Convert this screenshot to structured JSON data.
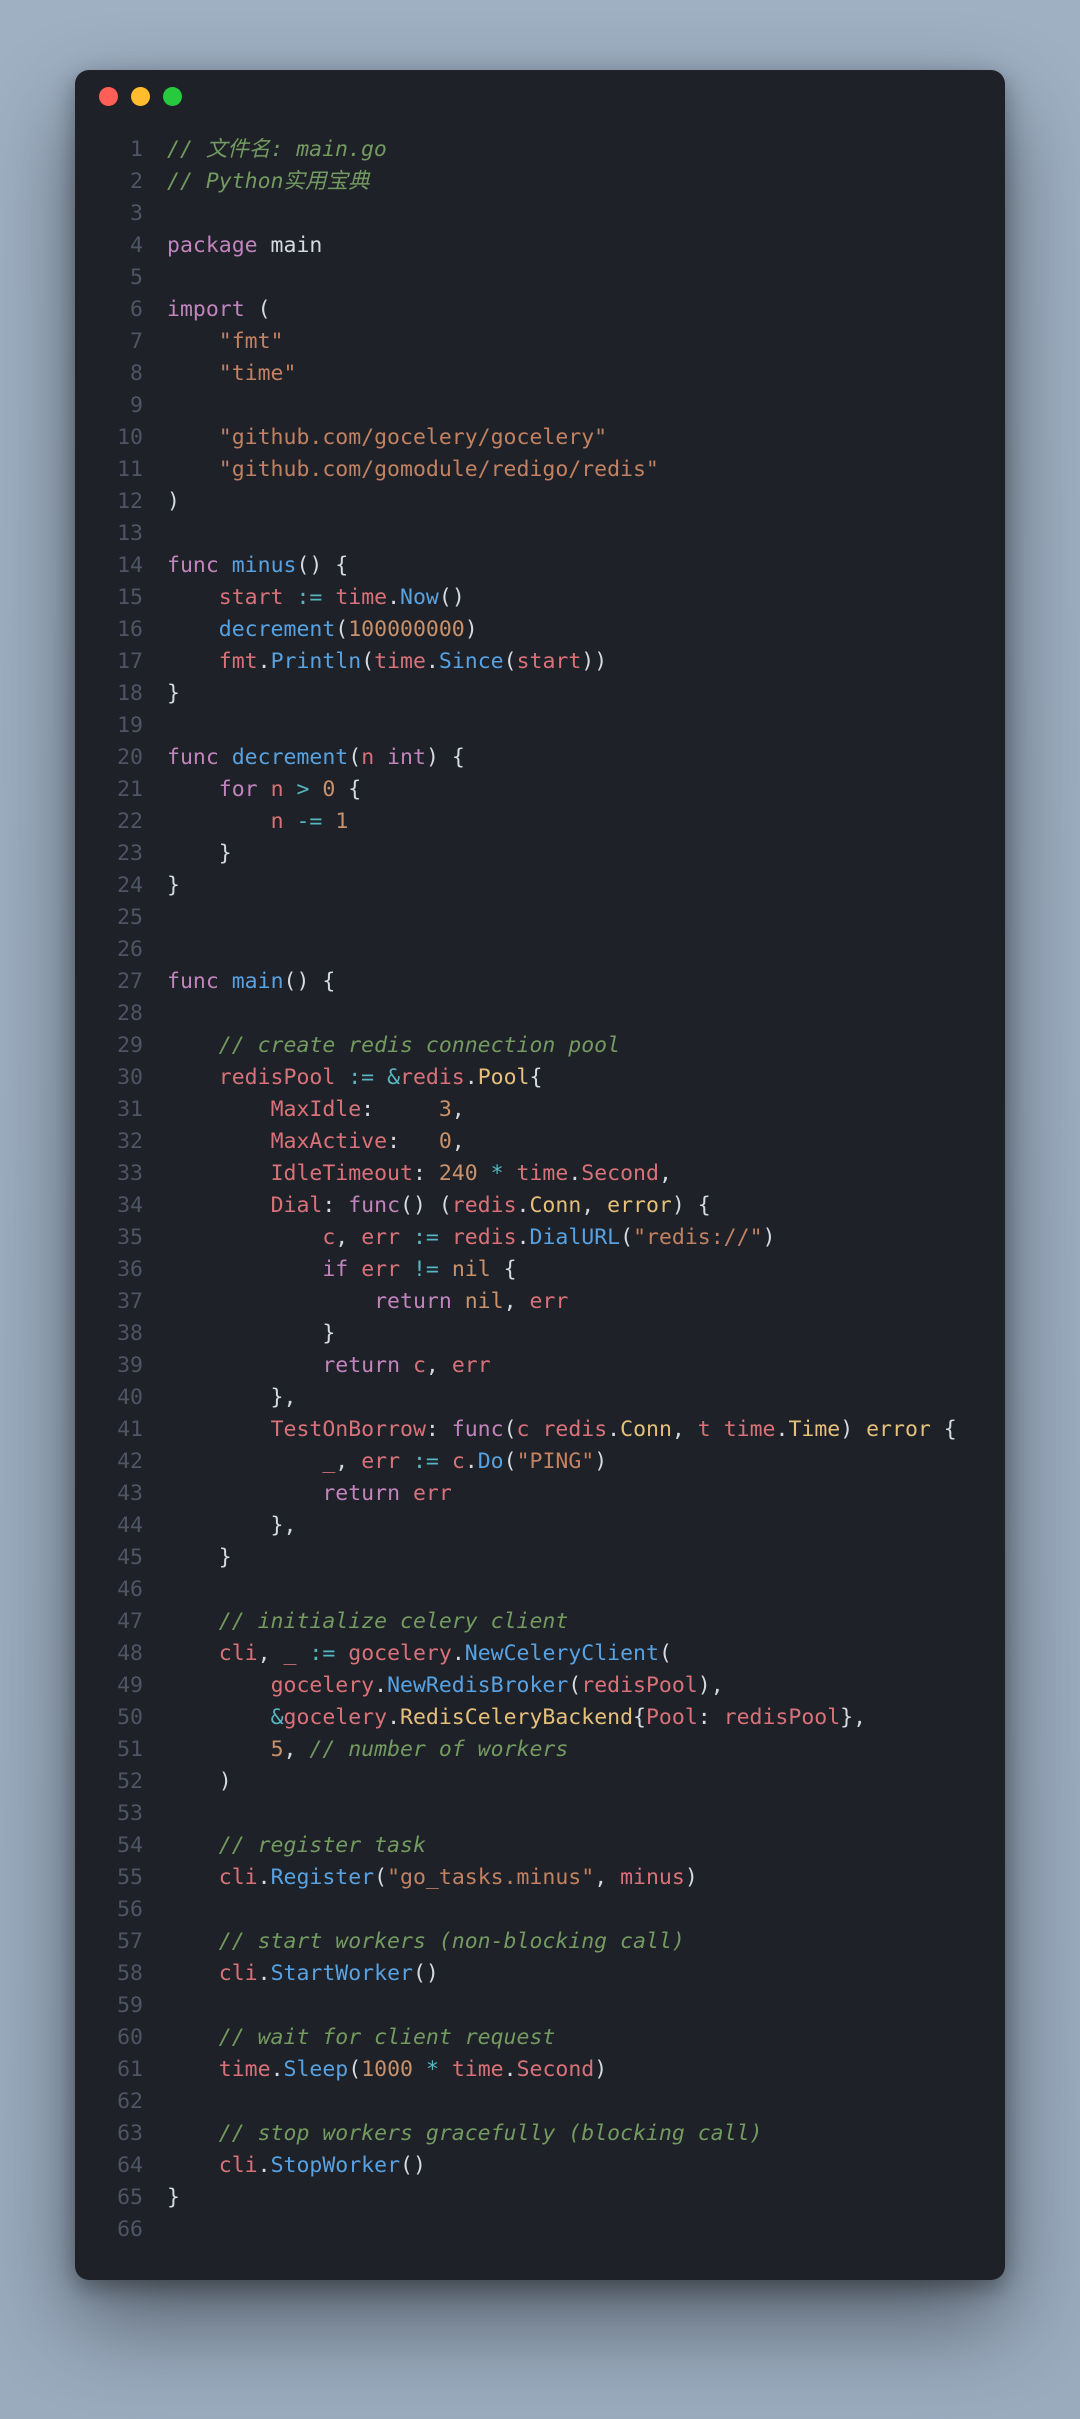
{
  "window": {
    "traffic_lights": [
      "red",
      "yellow",
      "green"
    ]
  },
  "code": {
    "lines": [
      [
        [
          "com",
          "// 文件名: main.go"
        ]
      ],
      [
        [
          "com",
          "// Python实用宝典"
        ]
      ],
      [],
      [
        [
          "kw",
          "package"
        ],
        [
          "wh",
          " main"
        ]
      ],
      [],
      [
        [
          "kw",
          "import"
        ],
        [
          "wh",
          " ("
        ]
      ],
      [
        [
          "wh",
          "    "
        ],
        [
          "str",
          "\"fmt\""
        ]
      ],
      [
        [
          "wh",
          "    "
        ],
        [
          "str",
          "\"time\""
        ]
      ],
      [],
      [
        [
          "wh",
          "    "
        ],
        [
          "str",
          "\"github.com/gocelery/gocelery\""
        ]
      ],
      [
        [
          "wh",
          "    "
        ],
        [
          "str",
          "\"github.com/gomodule/redigo/redis\""
        ]
      ],
      [
        [
          "wh",
          ")"
        ]
      ],
      [],
      [
        [
          "kw",
          "func"
        ],
        [
          "wh",
          " "
        ],
        [
          "func",
          "minus"
        ],
        [
          "wh",
          "() {"
        ]
      ],
      [
        [
          "wh",
          "    "
        ],
        [
          "red",
          "start"
        ],
        [
          "wh",
          " "
        ],
        [
          "op",
          ":="
        ],
        [
          "wh",
          " "
        ],
        [
          "red",
          "time"
        ],
        [
          "wh",
          "."
        ],
        [
          "func",
          "Now"
        ],
        [
          "wh",
          "()"
        ]
      ],
      [
        [
          "wh",
          "    "
        ],
        [
          "func",
          "decrement"
        ],
        [
          "wh",
          "("
        ],
        [
          "num",
          "100000000"
        ],
        [
          "wh",
          ")"
        ]
      ],
      [
        [
          "wh",
          "    "
        ],
        [
          "red",
          "fmt"
        ],
        [
          "wh",
          "."
        ],
        [
          "func",
          "Println"
        ],
        [
          "wh",
          "("
        ],
        [
          "red",
          "time"
        ],
        [
          "wh",
          "."
        ],
        [
          "func",
          "Since"
        ],
        [
          "wh",
          "("
        ],
        [
          "red",
          "start"
        ],
        [
          "wh",
          "))"
        ]
      ],
      [
        [
          "wh",
          "}"
        ]
      ],
      [],
      [
        [
          "kw",
          "func"
        ],
        [
          "wh",
          " "
        ],
        [
          "func",
          "decrement"
        ],
        [
          "wh",
          "("
        ],
        [
          "red",
          "n"
        ],
        [
          "wh",
          " "
        ],
        [
          "kw",
          "int"
        ],
        [
          "wh",
          ") {"
        ]
      ],
      [
        [
          "wh",
          "    "
        ],
        [
          "kw",
          "for"
        ],
        [
          "wh",
          " "
        ],
        [
          "red",
          "n"
        ],
        [
          "wh",
          " "
        ],
        [
          "op",
          ">"
        ],
        [
          "wh",
          " "
        ],
        [
          "num",
          "0"
        ],
        [
          "wh",
          " {"
        ]
      ],
      [
        [
          "wh",
          "        "
        ],
        [
          "red",
          "n"
        ],
        [
          "wh",
          " "
        ],
        [
          "op",
          "-="
        ],
        [
          "wh",
          " "
        ],
        [
          "num",
          "1"
        ]
      ],
      [
        [
          "wh",
          "    }"
        ]
      ],
      [
        [
          "wh",
          "}"
        ]
      ],
      [],
      [],
      [
        [
          "kw",
          "func"
        ],
        [
          "wh",
          " "
        ],
        [
          "func",
          "main"
        ],
        [
          "wh",
          "() {"
        ]
      ],
      [],
      [
        [
          "wh",
          "    "
        ],
        [
          "com",
          "// create redis connection pool"
        ]
      ],
      [
        [
          "wh",
          "    "
        ],
        [
          "red",
          "redisPool"
        ],
        [
          "wh",
          " "
        ],
        [
          "op",
          ":="
        ],
        [
          "wh",
          " "
        ],
        [
          "op",
          "&"
        ],
        [
          "red",
          "redis"
        ],
        [
          "wh",
          "."
        ],
        [
          "yel",
          "Pool"
        ],
        [
          "wh",
          "{"
        ]
      ],
      [
        [
          "wh",
          "        "
        ],
        [
          "red",
          "MaxIdle"
        ],
        [
          "wh",
          ":     "
        ],
        [
          "num",
          "3"
        ],
        [
          "wh",
          ","
        ]
      ],
      [
        [
          "wh",
          "        "
        ],
        [
          "red",
          "MaxActive"
        ],
        [
          "wh",
          ":   "
        ],
        [
          "num",
          "0"
        ],
        [
          "wh",
          ","
        ]
      ],
      [
        [
          "wh",
          "        "
        ],
        [
          "red",
          "IdleTimeout"
        ],
        [
          "wh",
          ": "
        ],
        [
          "num",
          "240"
        ],
        [
          "wh",
          " "
        ],
        [
          "op",
          "*"
        ],
        [
          "wh",
          " "
        ],
        [
          "red",
          "time"
        ],
        [
          "wh",
          "."
        ],
        [
          "red",
          "Second"
        ],
        [
          "wh",
          ","
        ]
      ],
      [
        [
          "wh",
          "        "
        ],
        [
          "red",
          "Dial"
        ],
        [
          "wh",
          ": "
        ],
        [
          "kw",
          "func"
        ],
        [
          "wh",
          "() ("
        ],
        [
          "red",
          "redis"
        ],
        [
          "wh",
          "."
        ],
        [
          "yel",
          "Conn"
        ],
        [
          "wh",
          ", "
        ],
        [
          "yel",
          "error"
        ],
        [
          "wh",
          ") {"
        ]
      ],
      [
        [
          "wh",
          "            "
        ],
        [
          "red",
          "c"
        ],
        [
          "wh",
          ", "
        ],
        [
          "red",
          "err"
        ],
        [
          "wh",
          " "
        ],
        [
          "op",
          ":="
        ],
        [
          "wh",
          " "
        ],
        [
          "red",
          "redis"
        ],
        [
          "wh",
          "."
        ],
        [
          "func",
          "DialURL"
        ],
        [
          "wh",
          "("
        ],
        [
          "str",
          "\"redis://\""
        ],
        [
          "wh",
          ")"
        ]
      ],
      [
        [
          "wh",
          "            "
        ],
        [
          "kw",
          "if"
        ],
        [
          "wh",
          " "
        ],
        [
          "red",
          "err"
        ],
        [
          "wh",
          " "
        ],
        [
          "op",
          "!="
        ],
        [
          "wh",
          " "
        ],
        [
          "num",
          "nil"
        ],
        [
          "wh",
          " {"
        ]
      ],
      [
        [
          "wh",
          "                "
        ],
        [
          "kw",
          "return"
        ],
        [
          "wh",
          " "
        ],
        [
          "num",
          "nil"
        ],
        [
          "wh",
          ", "
        ],
        [
          "red",
          "err"
        ]
      ],
      [
        [
          "wh",
          "            }"
        ]
      ],
      [
        [
          "wh",
          "            "
        ],
        [
          "kw",
          "return"
        ],
        [
          "wh",
          " "
        ],
        [
          "red",
          "c"
        ],
        [
          "wh",
          ", "
        ],
        [
          "red",
          "err"
        ]
      ],
      [
        [
          "wh",
          "        },"
        ]
      ],
      [
        [
          "wh",
          "        "
        ],
        [
          "red",
          "TestOnBorrow"
        ],
        [
          "wh",
          ": "
        ],
        [
          "kw",
          "func"
        ],
        [
          "wh",
          "("
        ],
        [
          "red",
          "c"
        ],
        [
          "wh",
          " "
        ],
        [
          "red",
          "redis"
        ],
        [
          "wh",
          "."
        ],
        [
          "yel",
          "Conn"
        ],
        [
          "wh",
          ", "
        ],
        [
          "red",
          "t"
        ],
        [
          "wh",
          " "
        ],
        [
          "red",
          "time"
        ],
        [
          "wh",
          "."
        ],
        [
          "yel",
          "Time"
        ],
        [
          "wh",
          ") "
        ],
        [
          "yel",
          "error"
        ],
        [
          "wh",
          " {"
        ]
      ],
      [
        [
          "wh",
          "            "
        ],
        [
          "red",
          "_"
        ],
        [
          "wh",
          ", "
        ],
        [
          "red",
          "err"
        ],
        [
          "wh",
          " "
        ],
        [
          "op",
          ":="
        ],
        [
          "wh",
          " "
        ],
        [
          "red",
          "c"
        ],
        [
          "wh",
          "."
        ],
        [
          "func",
          "Do"
        ],
        [
          "wh",
          "("
        ],
        [
          "str",
          "\"PING\""
        ],
        [
          "wh",
          ")"
        ]
      ],
      [
        [
          "wh",
          "            "
        ],
        [
          "kw",
          "return"
        ],
        [
          "wh",
          " "
        ],
        [
          "red",
          "err"
        ]
      ],
      [
        [
          "wh",
          "        },"
        ]
      ],
      [
        [
          "wh",
          "    }"
        ]
      ],
      [],
      [
        [
          "wh",
          "    "
        ],
        [
          "com",
          "// initialize celery client"
        ]
      ],
      [
        [
          "wh",
          "    "
        ],
        [
          "red",
          "cli"
        ],
        [
          "wh",
          ", "
        ],
        [
          "red",
          "_"
        ],
        [
          "wh",
          " "
        ],
        [
          "op",
          ":="
        ],
        [
          "wh",
          " "
        ],
        [
          "red",
          "gocelery"
        ],
        [
          "wh",
          "."
        ],
        [
          "func",
          "NewCeleryClient"
        ],
        [
          "wh",
          "("
        ]
      ],
      [
        [
          "wh",
          "        "
        ],
        [
          "red",
          "gocelery"
        ],
        [
          "wh",
          "."
        ],
        [
          "func",
          "NewRedisBroker"
        ],
        [
          "wh",
          "("
        ],
        [
          "red",
          "redisPool"
        ],
        [
          "wh",
          "),"
        ]
      ],
      [
        [
          "wh",
          "        "
        ],
        [
          "op",
          "&"
        ],
        [
          "red",
          "gocelery"
        ],
        [
          "wh",
          "."
        ],
        [
          "yel",
          "RedisCeleryBackend"
        ],
        [
          "wh",
          "{"
        ],
        [
          "red",
          "Pool"
        ],
        [
          "wh",
          ": "
        ],
        [
          "red",
          "redisPool"
        ],
        [
          "wh",
          "},"
        ]
      ],
      [
        [
          "wh",
          "        "
        ],
        [
          "num",
          "5"
        ],
        [
          "wh",
          ", "
        ],
        [
          "com",
          "// number of workers"
        ]
      ],
      [
        [
          "wh",
          "    )"
        ]
      ],
      [],
      [
        [
          "wh",
          "    "
        ],
        [
          "com",
          "// register task"
        ]
      ],
      [
        [
          "wh",
          "    "
        ],
        [
          "red",
          "cli"
        ],
        [
          "wh",
          "."
        ],
        [
          "func",
          "Register"
        ],
        [
          "wh",
          "("
        ],
        [
          "str",
          "\"go_tasks.minus\""
        ],
        [
          "wh",
          ", "
        ],
        [
          "red",
          "minus"
        ],
        [
          "wh",
          ")"
        ]
      ],
      [],
      [
        [
          "wh",
          "    "
        ],
        [
          "com",
          "// start workers (non-blocking call)"
        ]
      ],
      [
        [
          "wh",
          "    "
        ],
        [
          "red",
          "cli"
        ],
        [
          "wh",
          "."
        ],
        [
          "func",
          "StartWorker"
        ],
        [
          "wh",
          "()"
        ]
      ],
      [],
      [
        [
          "wh",
          "    "
        ],
        [
          "com",
          "// wait for client request"
        ]
      ],
      [
        [
          "wh",
          "    "
        ],
        [
          "red",
          "time"
        ],
        [
          "wh",
          "."
        ],
        [
          "func",
          "Sleep"
        ],
        [
          "wh",
          "("
        ],
        [
          "num",
          "1000"
        ],
        [
          "wh",
          " "
        ],
        [
          "op",
          "*"
        ],
        [
          "wh",
          " "
        ],
        [
          "red",
          "time"
        ],
        [
          "wh",
          "."
        ],
        [
          "red",
          "Second"
        ],
        [
          "wh",
          ")"
        ]
      ],
      [],
      [
        [
          "wh",
          "    "
        ],
        [
          "com",
          "// stop workers gracefully (blocking call)"
        ]
      ],
      [
        [
          "wh",
          "    "
        ],
        [
          "red",
          "cli"
        ],
        [
          "wh",
          "."
        ],
        [
          "func",
          "StopWorker"
        ],
        [
          "wh",
          "()"
        ]
      ],
      [
        [
          "wh",
          "}"
        ]
      ],
      []
    ]
  }
}
